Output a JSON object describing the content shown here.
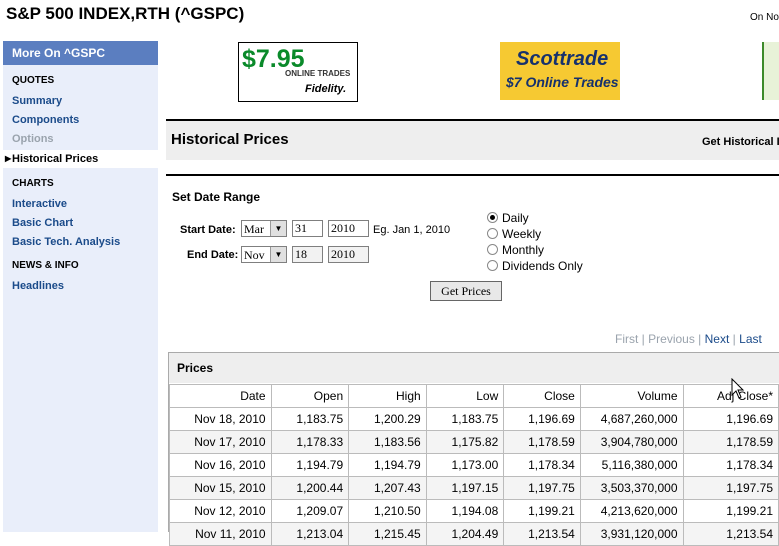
{
  "header": {
    "title": "S&P 500 INDEX,RTH (^GSPC)",
    "right_text": "On No"
  },
  "sidebar": {
    "heading": "More On ^GSPC",
    "sections": [
      {
        "title": "QUOTES",
        "items": [
          {
            "label": "Summary",
            "state": "link"
          },
          {
            "label": "Components",
            "state": "link"
          },
          {
            "label": "Options",
            "state": "disabled"
          },
          {
            "label": "Historical Prices",
            "state": "active"
          }
        ]
      },
      {
        "title": "CHARTS",
        "items": [
          {
            "label": "Interactive",
            "state": "link"
          },
          {
            "label": "Basic Chart",
            "state": "link"
          },
          {
            "label": "Basic Tech. Analysis",
            "state": "link"
          }
        ]
      },
      {
        "title": "NEWS & INFO",
        "items": [
          {
            "label": "Headlines",
            "state": "link"
          }
        ]
      }
    ]
  },
  "ads": {
    "fidelity": {
      "price": "$7.95",
      "tagline": "ONLINE TRADES",
      "brand": "Fidelity."
    },
    "scottrade": {
      "brand": "Scottrade",
      "tagline": "$7 Online Trades"
    }
  },
  "page": {
    "section_title": "Historical Prices",
    "right_link": "Get Historical I"
  },
  "date_range": {
    "title": "Set Date Range",
    "start_label": "Start Date:",
    "start": {
      "month": "Mar",
      "day": "31",
      "year": "2010"
    },
    "end_label": "End Date:",
    "end": {
      "month": "Nov",
      "day": "18",
      "year": "2010"
    },
    "example": "Eg. Jan 1, 2010",
    "frequency_options": [
      "Daily",
      "Weekly",
      "Monthly",
      "Dividends Only"
    ],
    "selected_frequency": "Daily",
    "button_label": "Get Prices"
  },
  "pagination": {
    "first": "First",
    "previous": "Previous",
    "next": "Next",
    "last": "Last",
    "separator": "|"
  },
  "prices": {
    "title": "Prices",
    "columns": [
      "Date",
      "Open",
      "High",
      "Low",
      "Close",
      "Volume",
      "Adj Close*"
    ],
    "rows": [
      [
        "Nov 18, 2010",
        "1,183.75",
        "1,200.29",
        "1,183.75",
        "1,196.69",
        "4,687,260,000",
        "1,196.69"
      ],
      [
        "Nov 17, 2010",
        "1,178.33",
        "1,183.56",
        "1,175.82",
        "1,178.59",
        "3,904,780,000",
        "1,178.59"
      ],
      [
        "Nov 16, 2010",
        "1,194.79",
        "1,194.79",
        "1,173.00",
        "1,178.34",
        "5,116,380,000",
        "1,178.34"
      ],
      [
        "Nov 15, 2010",
        "1,200.44",
        "1,207.43",
        "1,197.15",
        "1,197.75",
        "3,503,370,000",
        "1,197.75"
      ],
      [
        "Nov 12, 2010",
        "1,209.07",
        "1,210.50",
        "1,194.08",
        "1,199.21",
        "4,213,620,000",
        "1,199.21"
      ],
      [
        "Nov 11, 2010",
        "1,213.04",
        "1,215.45",
        "1,204.49",
        "1,213.54",
        "3,931,120,000",
        "1,213.54"
      ]
    ]
  },
  "colors": {
    "sidebar_bg": "#e9eefa",
    "sidebar_header": "#5b7ec0",
    "link": "#1b4b8a",
    "disabled": "#9aa3ad"
  }
}
